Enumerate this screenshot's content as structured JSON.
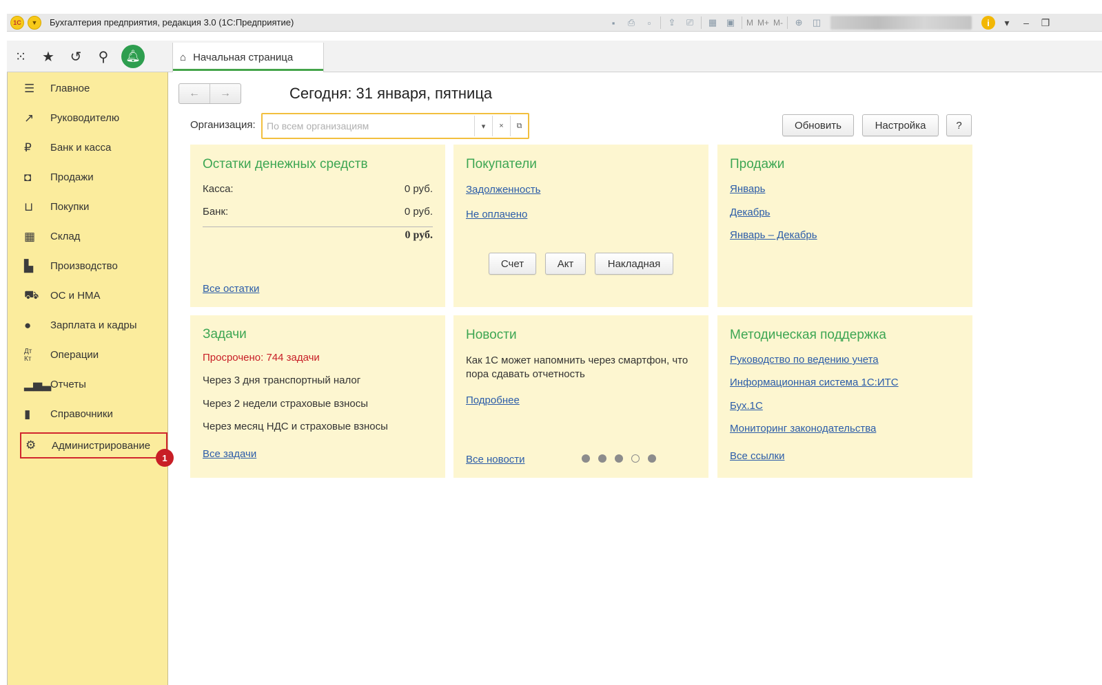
{
  "window": {
    "logo": "1С",
    "title": "Бухгалтерия предприятия, редакция 3.0  (1С:Предприятие)",
    "toolbar_m": [
      "M",
      "M+",
      "M-"
    ]
  },
  "tab": {
    "label": "Начальная страница"
  },
  "sidebar": {
    "items": [
      {
        "label": "Главное",
        "icon": "menu-lines-icon"
      },
      {
        "label": "Руководителю",
        "icon": "trend-icon"
      },
      {
        "label": "Банк и касса",
        "icon": "ruble-coin-icon"
      },
      {
        "label": "Продажи",
        "icon": "shopping-bag-icon"
      },
      {
        "label": "Покупки",
        "icon": "cart-icon"
      },
      {
        "label": "Склад",
        "icon": "warehouse-icon"
      },
      {
        "label": "Производство",
        "icon": "factory-icon"
      },
      {
        "label": "ОС и НМА",
        "icon": "truck-icon"
      },
      {
        "label": "Зарплата и кадры",
        "icon": "person-icon"
      },
      {
        "label": "Операции",
        "icon": "dt-kt-icon"
      },
      {
        "label": "Отчеты",
        "icon": "bar-chart-icon"
      },
      {
        "label": "Справочники",
        "icon": "books-icon"
      },
      {
        "label": "Администрирование",
        "icon": "gear-icon"
      }
    ],
    "badge": "1"
  },
  "main": {
    "today": "Сегодня: 31 января, пятница",
    "org_label": "Организация:",
    "org_placeholder": "По всем организациям",
    "refresh_button": "Обновить",
    "settings_button": "Настройка",
    "help_button": "?"
  },
  "panels": {
    "cash": {
      "title": "Остатки денежных средств",
      "rows": [
        {
          "label": "Касса:",
          "value": "0 руб."
        },
        {
          "label": "Банк:",
          "value": "0 руб."
        }
      ],
      "total": "0 руб.",
      "link": "Все остатки"
    },
    "buyers": {
      "title": "Покупатели",
      "links": [
        "Задолженность",
        "Не оплачено"
      ],
      "buttons": [
        "Счет",
        "Акт",
        "Накладная"
      ]
    },
    "sales": {
      "title": "Продажи",
      "links": [
        "Январь",
        "Декабрь",
        "Январь – Декабрь"
      ]
    },
    "tasks": {
      "title": "Задачи",
      "overdue": "Просрочено: 744 задачи",
      "items": [
        "Через 3 дня транспортный налог",
        "Через 2 недели страховые взносы",
        "Через месяц НДС и страховые взносы"
      ],
      "link": "Все задачи"
    },
    "news": {
      "title": "Новости",
      "text": "Как 1С может напомнить через смартфон, что пора сдавать отчетность",
      "more": "Подробнее",
      "link": "Все новости",
      "pages": 5,
      "current_page": 4
    },
    "support": {
      "title": "Методическая поддержка",
      "links": [
        "Руководство по ведению учета",
        "Информационная система 1С:ИТС",
        "Бух.1С",
        "Мониторинг законодательства"
      ],
      "all_link": "Все ссылки"
    }
  }
}
